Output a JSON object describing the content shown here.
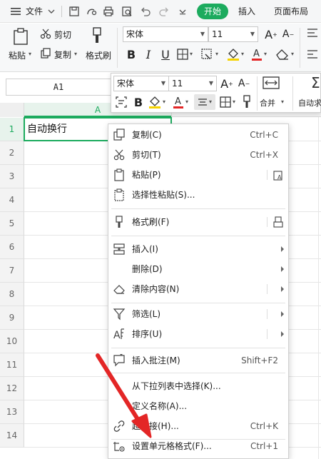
{
  "menubar": {
    "file_label": "文件",
    "tabs": [
      "开始",
      "插入",
      "页面布局"
    ]
  },
  "ribbon": {
    "paste_label": "粘贴",
    "cut_label": "剪切",
    "copy_label": "复制",
    "format_painter_label": "格式刷",
    "font_name": "宋体",
    "font_size": "11"
  },
  "namebox": {
    "value": "A1"
  },
  "grid": {
    "column_header": "A",
    "row_numbers": [
      "1",
      "2",
      "3",
      "4",
      "5",
      "6",
      "7",
      "8",
      "9",
      "10",
      "11",
      "12",
      "13",
      "14"
    ],
    "cell_a1": "自动换行"
  },
  "minibar": {
    "font_name": "宋体",
    "font_size": "11",
    "merge_label": "合并",
    "auto_label": "自动求"
  },
  "context_menu": {
    "items": [
      {
        "label": "复制(C)",
        "shortcut": "Ctrl+C",
        "icon": "copy-icon"
      },
      {
        "label": "剪切(T)",
        "shortcut": "Ctrl+X",
        "icon": "scissors-icon"
      },
      {
        "label": "粘贴(P)",
        "shortcut": "",
        "icon": "paste-icon"
      },
      {
        "label": "选择性粘贴(S)...",
        "shortcut": "",
        "icon": "paste-special-icon"
      },
      {
        "label": "格式刷(F)",
        "shortcut": "",
        "icon": "format-painter-icon"
      },
      {
        "label": "插入(I)",
        "shortcut": "",
        "icon": "insert-icon"
      },
      {
        "label": "删除(D)",
        "shortcut": "",
        "icon": ""
      },
      {
        "label": "清除内容(N)",
        "shortcut": "",
        "icon": "eraser-icon"
      },
      {
        "label": "筛选(L)",
        "shortcut": "",
        "icon": "filter-icon"
      },
      {
        "label": "排序(U)",
        "shortcut": "",
        "icon": "sort-icon"
      },
      {
        "label": "插入批注(M)",
        "shortcut": "Shift+F2",
        "icon": "comment-icon"
      },
      {
        "label": "从下拉列表中选择(K)...",
        "shortcut": "",
        "icon": ""
      },
      {
        "label": "定义名称(A)...",
        "shortcut": "",
        "icon": ""
      },
      {
        "label": "超链接(H)...",
        "shortcut": "Ctrl+K",
        "icon": "link-icon"
      },
      {
        "label": "设置单元格格式(F)...",
        "shortcut": "Ctrl+1",
        "icon": "format-cells-icon"
      }
    ]
  },
  "colors": {
    "accent_green": "#1cab5e",
    "annotation_arrow": "#e32626"
  }
}
